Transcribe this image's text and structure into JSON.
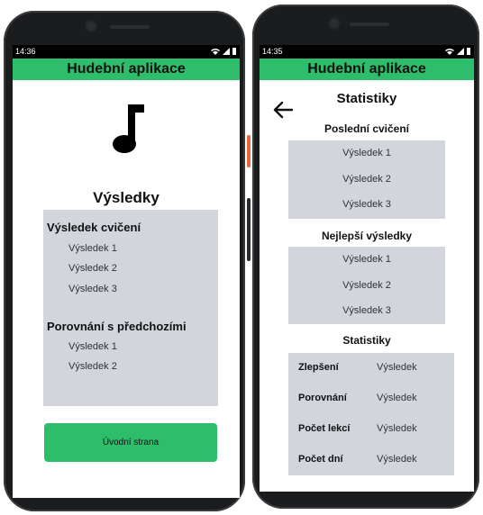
{
  "left_phone": {
    "status_time": "14:36",
    "app_title": "Hudební aplikace",
    "heading": "Výsledky",
    "sections": [
      {
        "title": "Výsledek cvičení",
        "items": [
          "Výsledek 1",
          "Výsledek 2",
          "Výsledek 3"
        ]
      },
      {
        "title": "Porovnání s předchozími",
        "items": [
          "Výsledek 1",
          "Výsledek 2"
        ]
      }
    ],
    "button_label": "Úvodní strana"
  },
  "right_phone": {
    "status_time": "14:35",
    "app_title": "Hudební aplikace",
    "heading": "Statistiky",
    "recent_title": "Poslední cvičení",
    "recent_items": [
      "Výsledek 1",
      "Výsledek 2",
      "Výsledek 3"
    ],
    "best_title": "Nejlepší výsledky",
    "best_items": [
      "Výsledek 1",
      "Výsledek 2",
      "Výsledek 3"
    ],
    "stats_title": "Statistiky",
    "stats_rows": [
      {
        "label": "Zlepšení",
        "value": "Výsledek"
      },
      {
        "label": "Porovnání",
        "value": "Výsledek"
      },
      {
        "label": "Počet lekcí",
        "value": "Výsledek"
      },
      {
        "label": "Počet dní",
        "value": "Výsledek"
      }
    ]
  },
  "icons": [
    "music-note-icon",
    "back-arrow-icon",
    "wifi-icon",
    "signal-icon",
    "battery-icon"
  ],
  "colors": {
    "accent": "#2ebd6b",
    "panel": "#d3d5dd",
    "device": "#1b1c1e"
  }
}
